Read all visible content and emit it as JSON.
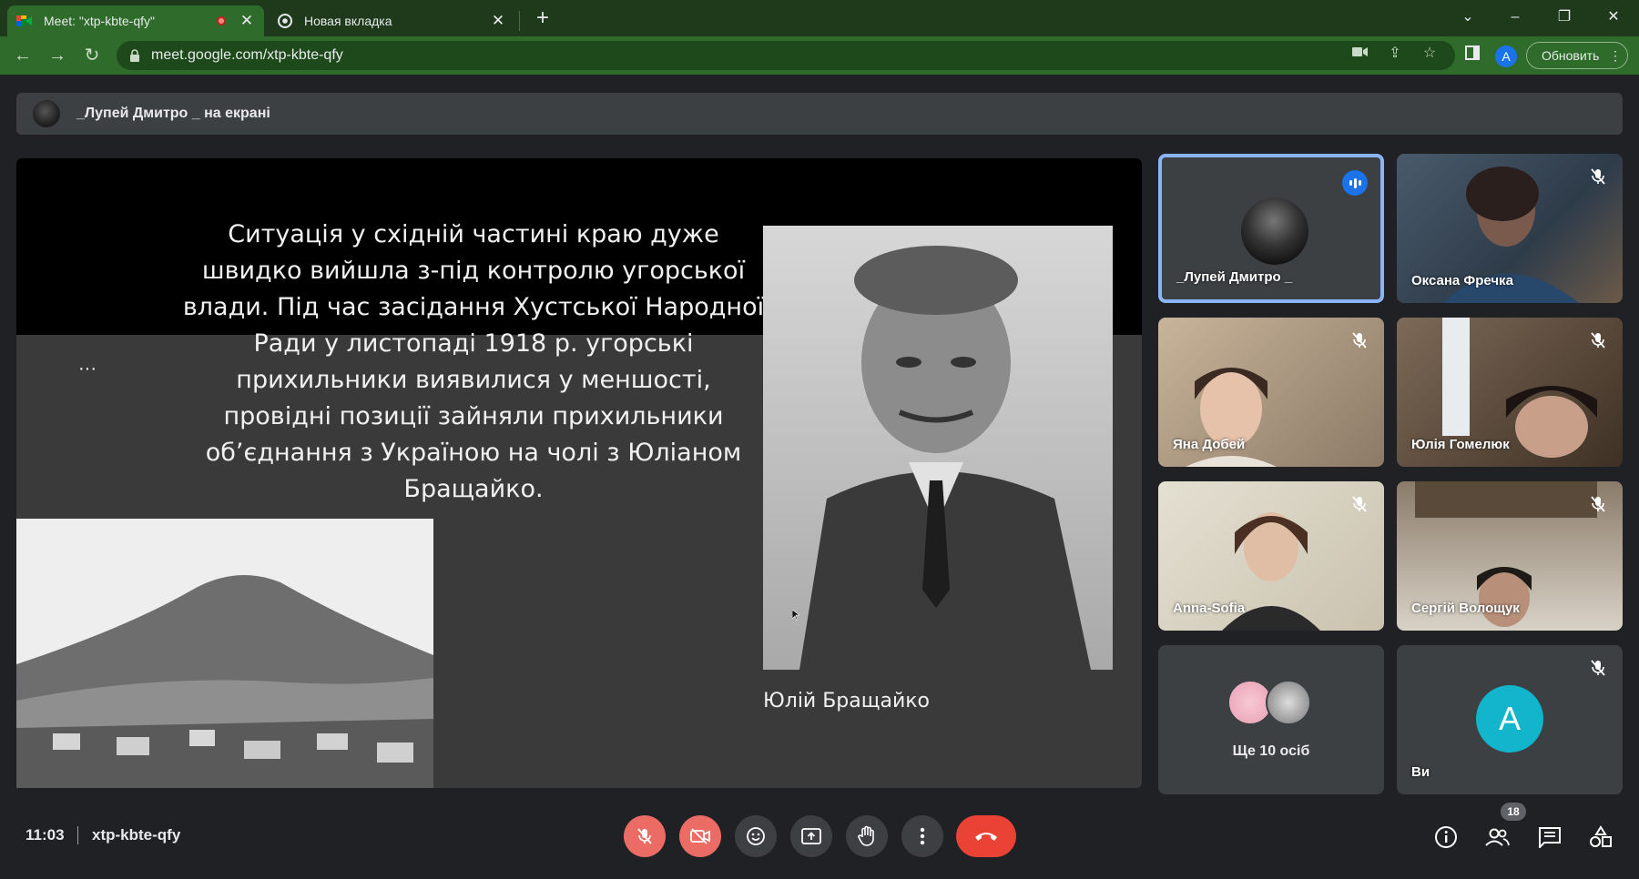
{
  "browser": {
    "tabs": [
      {
        "title": "Meet: \"xtp-kbte-qfy\"",
        "recording": true,
        "active": true
      },
      {
        "title": "Новая вкладка",
        "active": false
      }
    ],
    "url": "meet.google.com/xtp-kbte-qfy",
    "profile_initial": "A",
    "update_label": "Обновить"
  },
  "meet": {
    "presenter_banner": "_Лупей Дмитро _ на екрані",
    "slide": {
      "text": "Ситуація у східній частині краю дуже швидко вийшла з-під контролю угорської влади. Під час засідання Хустської Народної Ради у листопаді 1918 р. угорські прихильники виявилися у меншості, провідні позиції зайняли прихильники об’єднання з Україною на чолі з Юліаном Бращайко.",
      "caption": "Юлій Бращайко"
    },
    "participants": [
      {
        "name": "_Лупей Дмитро _",
        "speaking": true
      },
      {
        "name": "Оксана Фречка",
        "muted": true
      },
      {
        "name": "Яна Добей",
        "muted": true
      },
      {
        "name": "Юлія Гомелюк",
        "muted": true
      },
      {
        "name": "Anna-Sofia",
        "muted": true
      },
      {
        "name": "Сергій Волощук",
        "muted": true
      },
      {
        "more_label": "Ще 10 осіб"
      },
      {
        "name": "Ви",
        "initial": "A",
        "muted": true
      }
    ],
    "time": "11:03",
    "meeting_code": "xtp-kbte-qfy",
    "people_count": "18"
  },
  "colors": {
    "chrome_tab_bar": "#1e3a1b",
    "chrome_toolbar": "#2f6b2a",
    "meet_bg": "#202124",
    "hangup_red": "#ea4335",
    "speaking_outline": "#8ab4f8",
    "you_avatar": "#12b5cb"
  }
}
